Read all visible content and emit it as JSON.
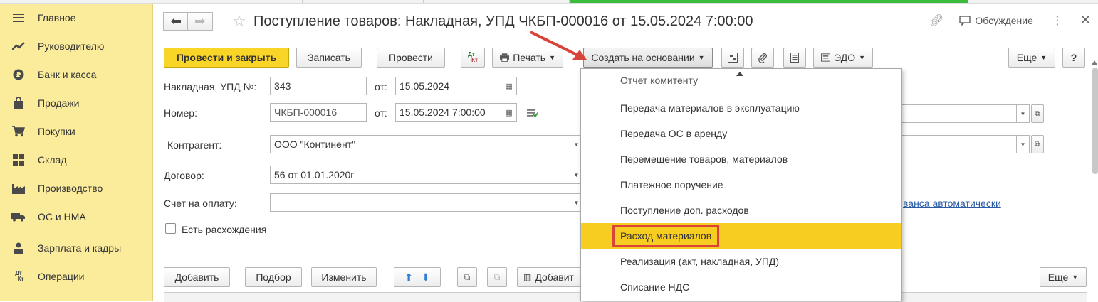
{
  "sidebar": {
    "items": [
      {
        "label": "Главное",
        "icon": "menu-lines-icon"
      },
      {
        "label": "Руководителю",
        "icon": "trend-chart-icon"
      },
      {
        "label": "Банк и касса",
        "icon": "coin-icon"
      },
      {
        "label": "Продажи",
        "icon": "shopping-bag-icon"
      },
      {
        "label": "Покупки",
        "icon": "shopping-cart-icon"
      },
      {
        "label": "Склад",
        "icon": "warehouse-icon"
      },
      {
        "label": "Производство",
        "icon": "factory-icon"
      },
      {
        "label": "ОС и НМА",
        "icon": "truck-icon"
      },
      {
        "label": "Зарплата и кадры",
        "icon": "person-icon"
      },
      {
        "label": "Операции",
        "icon": "dt-kt-icon"
      }
    ]
  },
  "header": {
    "title": "Поступление товаров: Накладная, УПД ЧКБП-000016 от 15.05.2024 7:00:00",
    "discussion": "Обсуждение"
  },
  "toolbar": {
    "post_close": "Провести и закрыть",
    "save": "Записать",
    "post": "Провести",
    "dtkt_top": "Дт",
    "dtkt_bottom": "Кт",
    "print": "Печать",
    "create_based": "Создать на основании",
    "edo": "ЭДО",
    "more": "Еще",
    "help": "?"
  },
  "form": {
    "invoice_label": "Накладная, УПД №:",
    "invoice_value": "343",
    "from_label": "от:",
    "invoice_date": "15.05.2024",
    "number_label": "Номер:",
    "number_value": "ЧКБП-000016",
    "number_date": "15.05.2024  7:00:00",
    "counterparty_label": "Контрагент:",
    "counterparty_value": "ООО \"Континент\"",
    "contract_label": "Договор:",
    "contract_value": "56 от 01.01.2020г",
    "invoice_pay_label": "Счет на оплату:",
    "invoice_pay_value": "",
    "discrepancy_label": "Есть расхождения",
    "advance_link": "ванса автоматически"
  },
  "table_toolbar": {
    "add": "Добавить",
    "pick": "Подбор",
    "change": "Изменить",
    "add_barcode": "Добавит",
    "more": "Еще"
  },
  "dropdown": {
    "items": [
      "Отчет комитенту",
      "Передача материалов в эксплуатацию",
      "Передача ОС в аренду",
      "Перемещение товаров, материалов",
      "Платежное поручение",
      "Поступление доп. расходов",
      "Расход материалов",
      "Реализация (акт, накладная, УПД)",
      "Списание НДС"
    ],
    "selected_index": 6
  },
  "colors": {
    "sidebar_bg": "#fbec9c",
    "primary_button": "#f9d527",
    "selected_item": "#f8cd22",
    "highlight_border": "#d9443a",
    "arrow": "#d9443a"
  }
}
